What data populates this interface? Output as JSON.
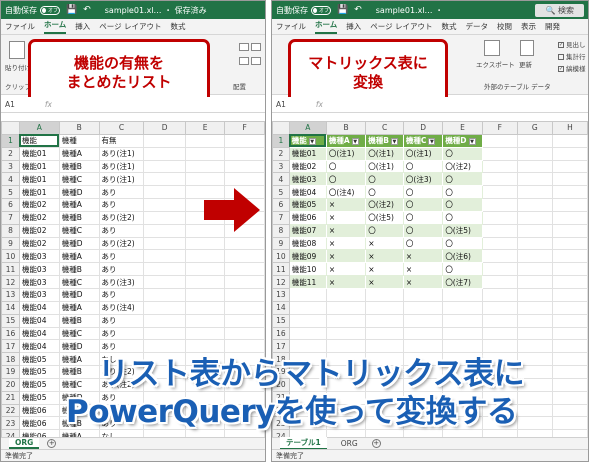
{
  "left_window": {
    "title": {
      "autosave": "自動保存",
      "toggle": "オフ",
      "filename": "sample01.xl… ・ 保存済み"
    },
    "tabs": [
      "ファイル",
      "ホーム",
      "挿入",
      "ページ レイアウト",
      "数式"
    ],
    "active_tab": "ホーム",
    "ribbon": {
      "paste_label": "貼り付け",
      "clipboard_label": "クリップボード",
      "alignment_label": "配置"
    },
    "callout": {
      "line1": "機能の有無を",
      "line2": "まとめたリスト"
    },
    "name_box": "A1",
    "columns": [
      "A",
      "B",
      "C",
      "D",
      "E",
      "F"
    ],
    "rows": [
      [
        "1",
        "機能",
        "機種",
        "有無"
      ],
      [
        "2",
        "機能01",
        "機種A",
        "あり(注1)"
      ],
      [
        "3",
        "機能01",
        "機種B",
        "あり(注1)"
      ],
      [
        "4",
        "機能01",
        "機種C",
        "あり(注1)"
      ],
      [
        "5",
        "機能01",
        "機種D",
        "あり"
      ],
      [
        "6",
        "機能02",
        "機種A",
        "あり"
      ],
      [
        "7",
        "機能02",
        "機種B",
        "あり(注2)"
      ],
      [
        "8",
        "機能02",
        "機種C",
        "あり"
      ],
      [
        "9",
        "機能02",
        "機種D",
        "あり(注2)"
      ],
      [
        "10",
        "機能03",
        "機種A",
        "あり"
      ],
      [
        "11",
        "機能03",
        "機種B",
        "あり"
      ],
      [
        "12",
        "機能03",
        "機種C",
        "あり(注3)"
      ],
      [
        "13",
        "機能03",
        "機種D",
        "あり"
      ],
      [
        "14",
        "機能04",
        "機種A",
        "あり(注4)"
      ],
      [
        "15",
        "機能04",
        "機種B",
        "あり"
      ],
      [
        "16",
        "機能04",
        "機種C",
        "あり"
      ],
      [
        "17",
        "機能04",
        "機種D",
        "あり"
      ],
      [
        "18",
        "機能05",
        "機種A",
        "なし"
      ],
      [
        "19",
        "機能05",
        "機種B",
        "あり(注2)"
      ],
      [
        "20",
        "機能05",
        "機種C",
        "あり(注2)"
      ],
      [
        "21",
        "機能05",
        "機種D",
        "あり"
      ],
      [
        "22",
        "機能06",
        "機種A",
        "なし"
      ],
      [
        "23",
        "機能06",
        "機種B",
        "あり"
      ],
      [
        "24",
        "機能06",
        "機種A",
        "なし"
      ]
    ],
    "sheet_tabs": [
      "ORG"
    ],
    "status": "準備完了"
  },
  "right_window": {
    "title": {
      "autosave": "自動保存",
      "toggle": "オフ",
      "filename": "sample01.xl… ・",
      "search": "検索"
    },
    "tabs": [
      "ファイル",
      "ホーム",
      "挿入",
      "ページ レイアウト",
      "数式",
      "データ",
      "校閲",
      "表示",
      "開発"
    ],
    "active_tab": "ホーム",
    "ribbon": {
      "export_label": "エクスポート",
      "refresh_label": "更新",
      "ext_data_label": "外部のテーブル データ",
      "check1": "見出し",
      "check2": "集計行",
      "check3": "縞模様"
    },
    "callout": {
      "line1": "マトリックス表に",
      "line2": "変換"
    },
    "name_box": "A1",
    "columns": [
      "A",
      "B",
      "C",
      "D",
      "E",
      "F",
      "G",
      "H"
    ],
    "header_row": [
      "機能",
      "機種A",
      "機種B",
      "機種C",
      "機種D"
    ],
    "rows": [
      [
        "2",
        "機能01",
        "〇(注1)",
        "〇(注1)",
        "〇(注1)",
        "〇"
      ],
      [
        "3",
        "機能02",
        "〇",
        "〇(注1)",
        "〇",
        "〇(注2)"
      ],
      [
        "4",
        "機能03",
        "〇",
        "〇",
        "〇(注3)",
        "〇"
      ],
      [
        "5",
        "機能04",
        "〇(注4)",
        "〇",
        "〇",
        "〇"
      ],
      [
        "6",
        "機能05",
        "×",
        "〇(注2)",
        "〇",
        "〇"
      ],
      [
        "7",
        "機能06",
        "×",
        "〇(注5)",
        "〇",
        "〇"
      ],
      [
        "8",
        "機能07",
        "×",
        "〇",
        "〇",
        "〇(注5)"
      ],
      [
        "9",
        "機能08",
        "×",
        "×",
        "〇",
        "〇"
      ],
      [
        "10",
        "機能09",
        "×",
        "×",
        "×",
        "〇(注6)"
      ],
      [
        "11",
        "機能10",
        "×",
        "×",
        "×",
        "〇"
      ],
      [
        "12",
        "機能11",
        "×",
        "×",
        "×",
        "〇(注7)"
      ]
    ],
    "empty_rows": [
      "13",
      "14",
      "15",
      "16",
      "17",
      "18",
      "19",
      "20",
      "21",
      "22",
      "23",
      "24"
    ],
    "sheet_tabs": [
      "テーブル1",
      "ORG"
    ],
    "status": "準備完了"
  },
  "headline": {
    "line1": "リスト表からマトリックス表に",
    "line2": "PowerQueryを使って変換する"
  },
  "colors": {
    "excel_green": "#217346",
    "table_header": "#70ad47",
    "band": "#e2efda",
    "callout_red": "#c00000",
    "arrow_red": "#c00000",
    "headline_blue": "#1a5fb4"
  }
}
